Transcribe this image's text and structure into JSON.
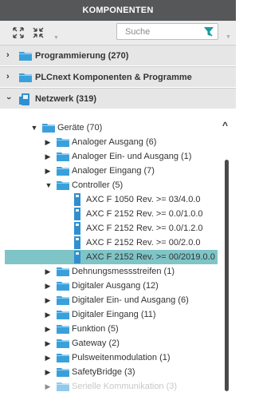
{
  "header": {
    "title": "KOMPONENTEN"
  },
  "toolbar": {
    "expand_icon": "expand-arrows-icon",
    "collapse_icon": "collapse-arrows-icon",
    "search_placeholder": "Suche",
    "filter_icon": "filter-icon"
  },
  "sections": [
    {
      "label": "Programmierung (270)",
      "expanded": false
    },
    {
      "label": "PLCnext Komponenten & Programme",
      "expanded": false
    },
    {
      "label": "Netzwerk (319)",
      "expanded": true
    }
  ],
  "tree": {
    "root": "Geräte (70)",
    "items": [
      "Analoger Ausgang (6)",
      "Analoger Ein- und Ausgang (1)",
      "Analoger Eingang (7)",
      "Controller (5)",
      "AXC F 1050 Rev. >= 03/4.0.0",
      "AXC F 2152 Rev. >= 0.0/1.0.0",
      "AXC F 2152 Rev. >= 0.0/1.2.0",
      "AXC F 2152 Rev. >= 00/2.0.0",
      "AXC F 2152 Rev. >= 00/2019.0.0",
      "Dehnungsmessstreifen (1)",
      "Digitaler Ausgang (12)",
      "Digitaler Ein- und Ausgang (6)",
      "Digitaler Eingang (11)",
      "Funktion (5)",
      "Gateway (2)",
      "Pulsweitenmodulation (1)",
      "SafetyBridge (3)",
      "Serielle Kommunikation (3)"
    ],
    "selected": "AXC F 2152 Rev. >= 00/2019.0.0"
  },
  "colors": {
    "header_bg": "#555759",
    "folder": "#3aa0dc",
    "device": "#2f8fd0",
    "selection": "#7fc4c6",
    "filter_accent": "#1a9aa0"
  }
}
